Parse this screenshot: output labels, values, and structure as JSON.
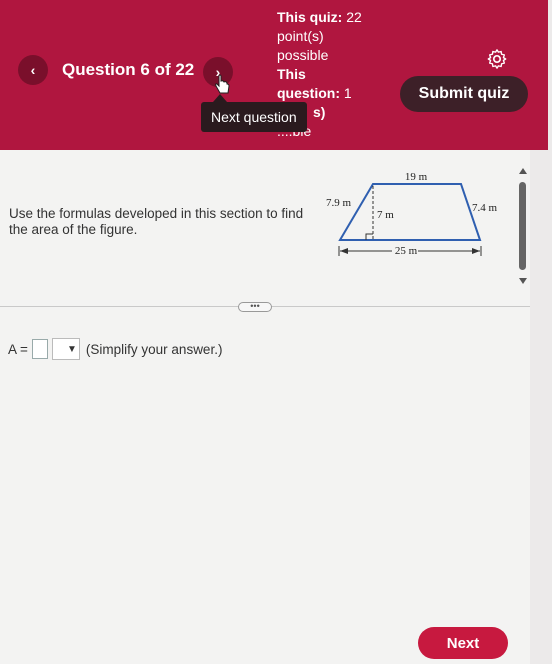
{
  "header": {
    "prev_label": "‹",
    "next_label": "›",
    "question_counter": "Question 6 of 22",
    "quiz_points_label": "This quiz:",
    "quiz_points_value": "22",
    "quiz_points_unit": "point(s)",
    "quiz_points_suffix": "possible",
    "question_points_label": "This",
    "question_points_label2": "question:",
    "question_points_value": "1",
    "question_points_unit": "s)",
    "question_points_suffix": "....ble",
    "tooltip": "Next question",
    "submit_label": "Submit quiz"
  },
  "question": {
    "prompt": "Use the formulas developed in this section to find the area of the figure.",
    "figure": {
      "top_label": "19 m",
      "left_label": "7.9 m",
      "height_label": "7 m",
      "right_label": "7.4 m",
      "bottom_label": "25 m"
    },
    "more_label": "•••"
  },
  "answer": {
    "label": "A =",
    "input_value": "",
    "select_value": "",
    "hint": "(Simplify your answer.)"
  },
  "footer": {
    "next_label": "Next"
  },
  "colors": {
    "header": "#b0163f",
    "submit": "#3d2028",
    "next": "#c7193f"
  }
}
